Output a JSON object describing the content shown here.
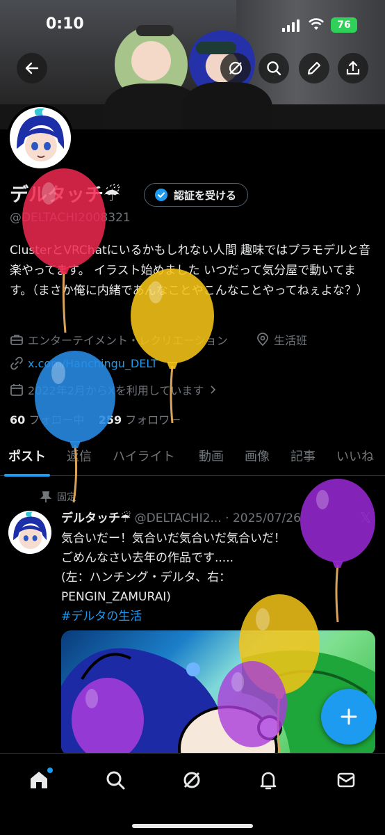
{
  "status_bar": {
    "time": "0:10",
    "battery": "76"
  },
  "top_actions": [
    "back-arrow-icon",
    "grok-icon",
    "search-icon",
    "edit-icon",
    "share-icon"
  ],
  "profile": {
    "name": "デルタッチ☔",
    "verify_button": "認証を受ける",
    "handle": "@DELTACHI2008321",
    "bio": "ClusterとVRChatにいるかもしれない人間 趣味ではプラモデルと音楽やってます。 イラスト始めました いつだって気分屋で動いてます。（まさか俺に内緒であんなことやこんなことやってねぇよな？）",
    "category": "エンターテイメント・レクリエーション",
    "location": "生活班",
    "link": "x.com/Hanchingu_DELT",
    "joined": "2022年2月からXを利用しています",
    "following_count": "60",
    "following_label": "フォロー中",
    "followers_count": "259",
    "followers_label": "フォロワー"
  },
  "tabs": [
    "ポスト",
    "返信",
    "ハイライト",
    "動画",
    "画像",
    "記事",
    "いいね"
  ],
  "active_tab": "ポスト",
  "post": {
    "pinned_label": "固定",
    "author_name": "デルタッチ☔",
    "author_handle": "@DELTACHI2...",
    "date": "2025/07/26",
    "line1": "気合いだー！気合いだ気合いだ気合いだ！",
    "line2": "ごめんなさい去年の作品です.....",
    "line3": "(左：ハンチング・デルタ、右：",
    "line4": "PENGIN_ZAMURAI)",
    "hashtag": "#デルタの生活"
  },
  "bottom_nav": [
    "home-icon",
    "search-icon",
    "grok-icon",
    "notifications-icon",
    "messages-icon"
  ],
  "colors": {
    "accent": "#1d9bf0",
    "background": "#000000",
    "muted": "#71767b",
    "text": "#e7e9ea"
  },
  "balloons": [
    "red",
    "yellow",
    "blue",
    "purple",
    "yellow",
    "purple",
    "purple"
  ]
}
